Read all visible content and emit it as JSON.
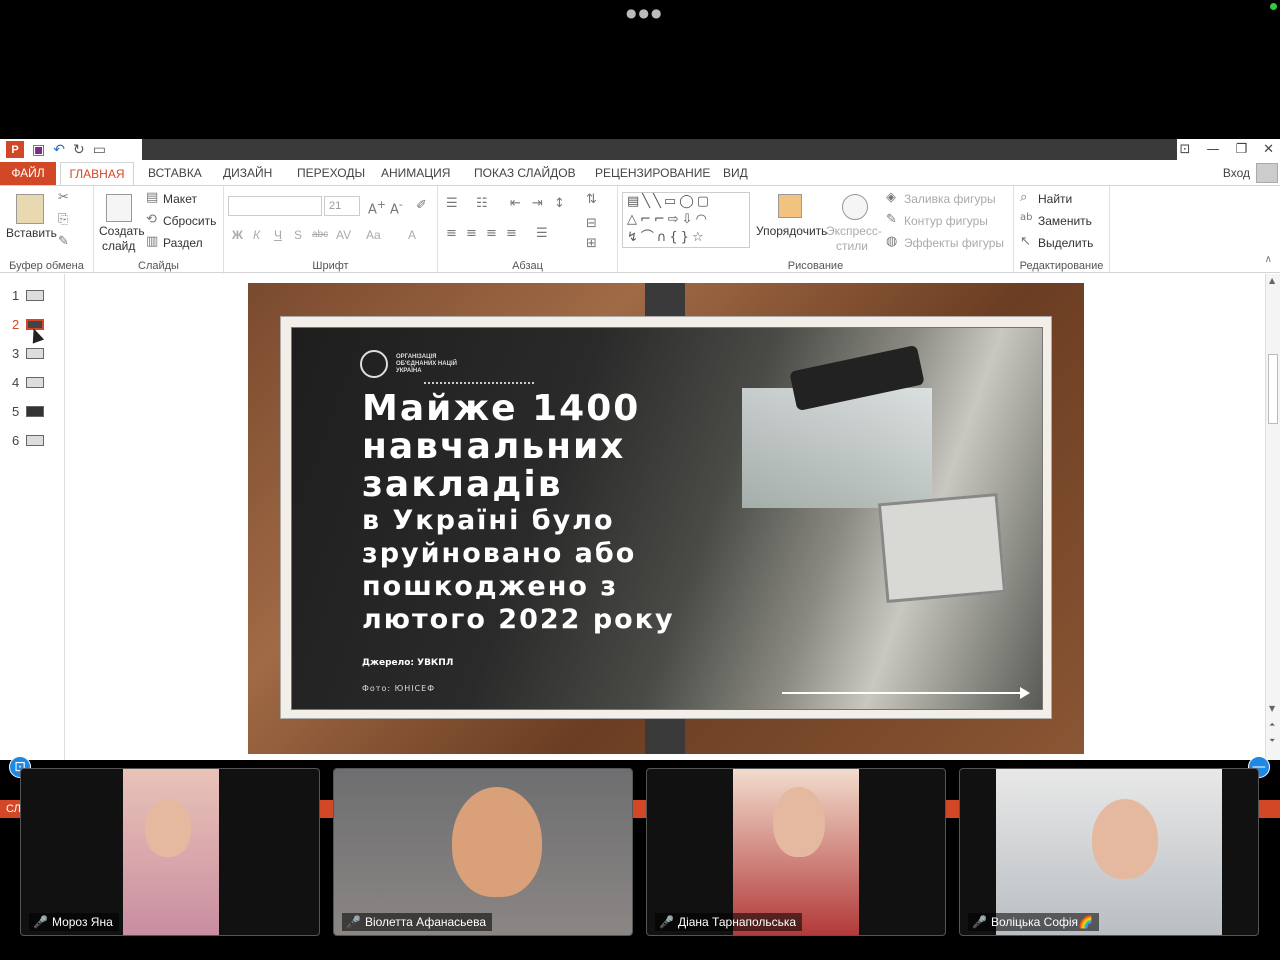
{
  "window": {
    "qat_icons": [
      "powerpoint-logo",
      "save-icon",
      "undo-icon",
      "redo-icon",
      "start-icon"
    ],
    "ppt_logo_letter": "P"
  },
  "tabs": {
    "file": "ФАЙЛ",
    "home": "ГЛАВНАЯ",
    "insert": "ВСТАВКА",
    "design": "ДИЗАЙН",
    "transitions": "ПЕРЕХОДЫ",
    "animation": "АНИМАЦИЯ",
    "slideshow": "ПОКАЗ СЛАЙДОВ",
    "review": "РЕЦЕНЗИРОВАНИЕ",
    "view": "ВИД",
    "login": "Вход"
  },
  "ribbon": {
    "clipboard": {
      "label": "Буфер обмена",
      "paste": "Вставить"
    },
    "slides": {
      "label": "Слайды",
      "new_slide_1": "Создать",
      "new_slide_2": "слайд",
      "layout": "Макет",
      "reset": "Сбросить",
      "section": "Раздел"
    },
    "font": {
      "label": "Шрифт",
      "size": "21",
      "bold": "Ж",
      "italic": "К",
      "underline": "Ч",
      "strike": "S",
      "abc": "abc",
      "spacing": "AV",
      "case": "Aa",
      "color": "A"
    },
    "paragraph": {
      "label": "Абзац"
    },
    "drawing": {
      "label": "Рисование",
      "arrange": "Упорядочить",
      "quick_styles_1": "Экспресс-",
      "quick_styles_2": "стили",
      "shape_fill": "Заливка фигуры",
      "shape_outline": "Контур фигуры",
      "shape_effects": "Эффекты фигуры"
    },
    "editing": {
      "label": "Редактирование",
      "find": "Найти",
      "replace": "Заменить",
      "select": "Выделить"
    }
  },
  "thumbnails": [
    "1",
    "2",
    "3",
    "4",
    "5",
    "6"
  ],
  "selected_slide": "2",
  "slide": {
    "org_lines": [
      "ОРГАНІЗАЦІЯ",
      "ОБ'ЄДНАНИХ НАЦІЙ",
      "УКРАЇНА"
    ],
    "headline_big": [
      "Майже 1400",
      "навчальних",
      "закладів"
    ],
    "headline_small": [
      "в Україні було",
      "зруйновано або",
      "пошкоджено з",
      "лютого 2022 року"
    ],
    "source": "Джерело: УВКПЛ",
    "photo_credit": "Фото: ЮНІСЕФ"
  },
  "status": {
    "left": "СЛ"
  },
  "participants": [
    {
      "name": "Мороз Яна"
    },
    {
      "name": "Віолетта Афанасьева"
    },
    {
      "name": "Діана Тарнапольська"
    },
    {
      "name": "Воліцька Софія🌈"
    }
  ],
  "colors": {
    "accent": "#d24726",
    "bg": "#000000",
    "mic_off": "#e53935",
    "side_button": "#1e88e5"
  }
}
